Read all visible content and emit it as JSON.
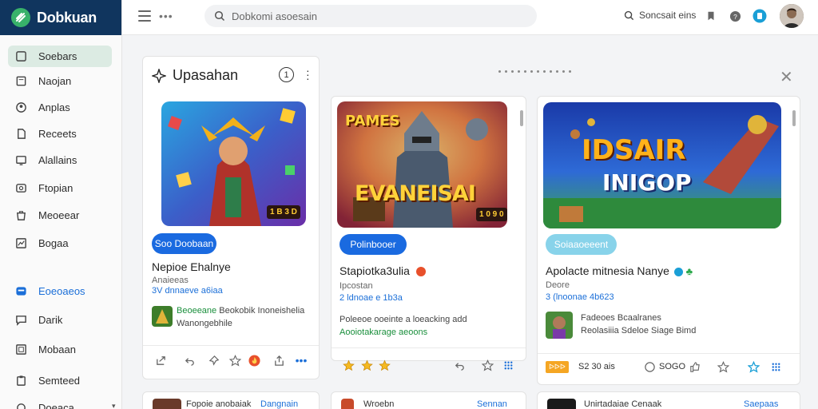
{
  "app": {
    "name": "Dobkuan"
  },
  "topbar": {
    "search_placeholder": "Dobkomi asoesain",
    "right_label": "Soncsait eins"
  },
  "sidebar": {
    "items": [
      {
        "label": "Soebars",
        "icon": "grid-icon",
        "active": true
      },
      {
        "label": "Naojan",
        "icon": "square-icon"
      },
      {
        "label": "Anplas",
        "icon": "user-icon"
      },
      {
        "label": "Receets",
        "icon": "document-icon"
      },
      {
        "label": "Alallains",
        "icon": "monitor-icon"
      },
      {
        "label": "Ftopian",
        "icon": "camera-icon"
      },
      {
        "label": "Meoeear",
        "icon": "bag-icon"
      },
      {
        "label": "Bogaa",
        "icon": "chart-icon"
      },
      {
        "label": "Eoeoaeos",
        "icon": "chat-icon",
        "highlight": true
      },
      {
        "label": "Darik",
        "icon": "message-icon"
      },
      {
        "label": "Mobaan",
        "icon": "grid-small-icon"
      },
      {
        "label": "Semteed",
        "icon": "clipboard-icon"
      },
      {
        "label": "Doeaca",
        "icon": "settings-icon"
      }
    ]
  },
  "panel": {
    "title": "Upasahan",
    "info_number": "1"
  },
  "cards": [
    {
      "badge": "",
      "pill": "Soo Doobaan",
      "title": "Nepioe Ehalnye",
      "sub": "Anaieeas",
      "meta": "3V dnnaeve a6iaa",
      "desc_green": "Beoeeane",
      "desc_rest": "Beokobik Inoneishelia",
      "desc_line2": "Wanongebhile"
    },
    {
      "badge": "PAMES",
      "art_title": "EVANEISAI",
      "pill": "Polinbooer",
      "title": "Stapiotka3ulia",
      "sub": "Ipcostan",
      "meta": "2 ldnoae e 1b3a",
      "desc_line1": "Poleeoe ooeinte a loeacking add",
      "desc_line2": "Aooiotakarage aeoons"
    },
    {
      "art_title_top": "IDSAIR",
      "art_title_bottom": "INIGOP",
      "pill": "Soiaaoeeent",
      "title": "Apolacte mitnesia Nanye",
      "sub": "Deore",
      "meta": "3 (lnoonae 4b623",
      "desc_line1": "Fadeoes Bcaalranes",
      "desc_line2": "Reolasiiia Sdeloe Siage Bimd",
      "footer_tag": "S2 30 ais",
      "footer_tag2": "SOGO"
    }
  ],
  "bottom_cards": [
    {
      "title": "Fopoie anobaiak",
      "badge": "Dangnain"
    },
    {
      "title": "Wroebn",
      "badge": "Sennan"
    },
    {
      "title": "Unirtadaiae Cenaak",
      "badge": "Saepaas"
    }
  ],
  "colors": {
    "brand": "#10355e",
    "accent": "#1a6ae0",
    "active_nav": "#dcebe3"
  }
}
